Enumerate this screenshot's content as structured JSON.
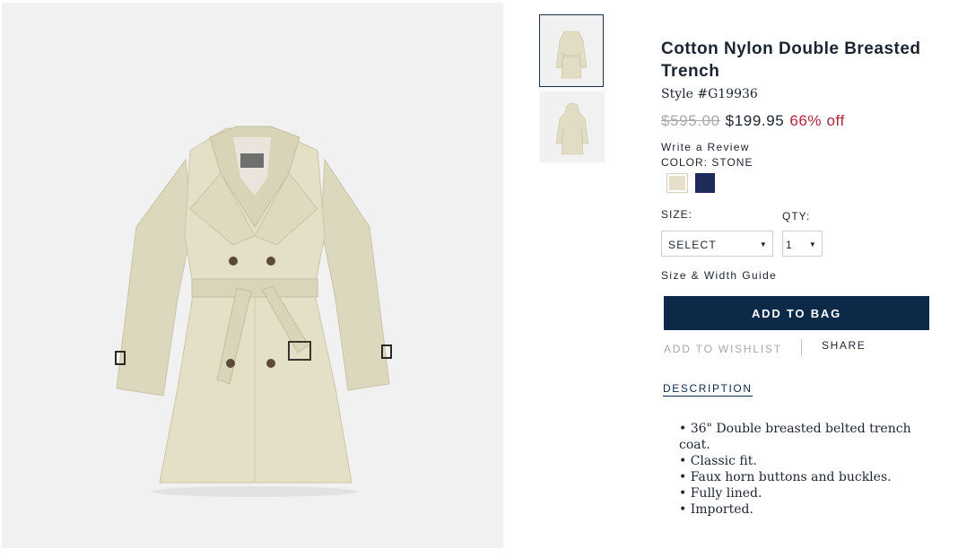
{
  "gallery": {
    "main_image": "trench-coat-photo",
    "thumbnails": [
      "trench-coat-front-thumbnail",
      "trench-coat-hood-thumbnail"
    ],
    "background_color": "#f1f1f1",
    "coat_color": "#e4e0c8"
  },
  "product": {
    "title": "Cotton Nylon Double Breasted Trench",
    "style": "Style #G19936",
    "price_original": "$595.00",
    "price_sale": "$199.95",
    "discount": "66% off",
    "review_link": "Write a Review",
    "color_label": "COLOR: STONE",
    "swatches": [
      {
        "name": "stone",
        "color": "#e6e0cb"
      },
      {
        "name": "navy",
        "color": "#1e2a5a"
      }
    ],
    "size_label": "SIZE:",
    "size_value": "SELECT",
    "qty_label": "QTY:",
    "qty_value": "1",
    "size_guide": "Size & Width Guide",
    "add_to_bag": "ADD TO BAG",
    "add_to_wishlist": "ADD TO WISHLIST",
    "share": "SHARE",
    "description_tab": "DESCRIPTION",
    "description_items": [
      "36\" Double breasted belted trench coat.",
      "Classic fit.",
      "Faux horn buttons and buckles.",
      "Fully lined.",
      "Imported."
    ]
  },
  "colors": {
    "navy_button": "#0c2a48",
    "sale_red": "#b0233a",
    "strike_gray": "#a8a8a8"
  }
}
